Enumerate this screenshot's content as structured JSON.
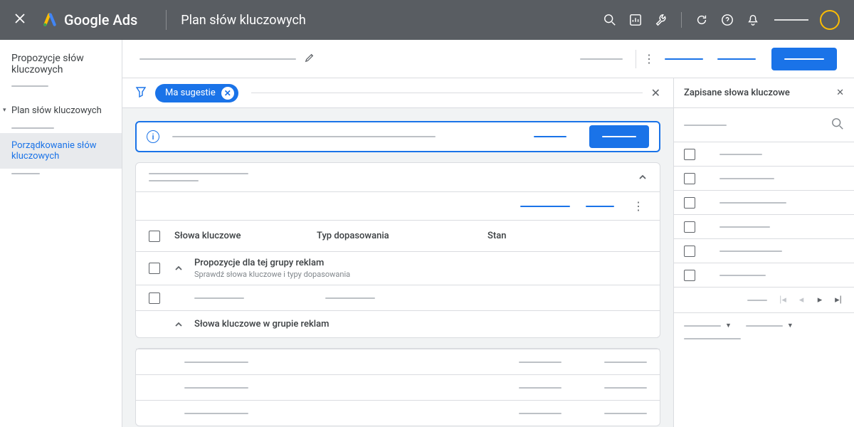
{
  "header": {
    "product": "Google Ads",
    "page_title": "Plan słów kluczowych"
  },
  "sidebar": {
    "section_title": "Propozycje słów kluczowych",
    "plan_item": "Plan słów kluczowych",
    "active_item": "Porządkowanie słów kluczowych"
  },
  "filter": {
    "chip_label": "Ma sugestie"
  },
  "table": {
    "col_keywords": "Słowa kluczowe",
    "col_match": "Typ dopasowania",
    "col_state": "Stan",
    "group_suggest_title": "Propozycje dla tej grupy reklam",
    "group_suggest_sub": "Sprawdź słowa kluczowe i typy dopasowania",
    "group_in_title": "Słowa kluczowe w grupie reklam"
  },
  "panel": {
    "title": "Zapisane słowa kluczowe",
    "item_count": 6
  }
}
